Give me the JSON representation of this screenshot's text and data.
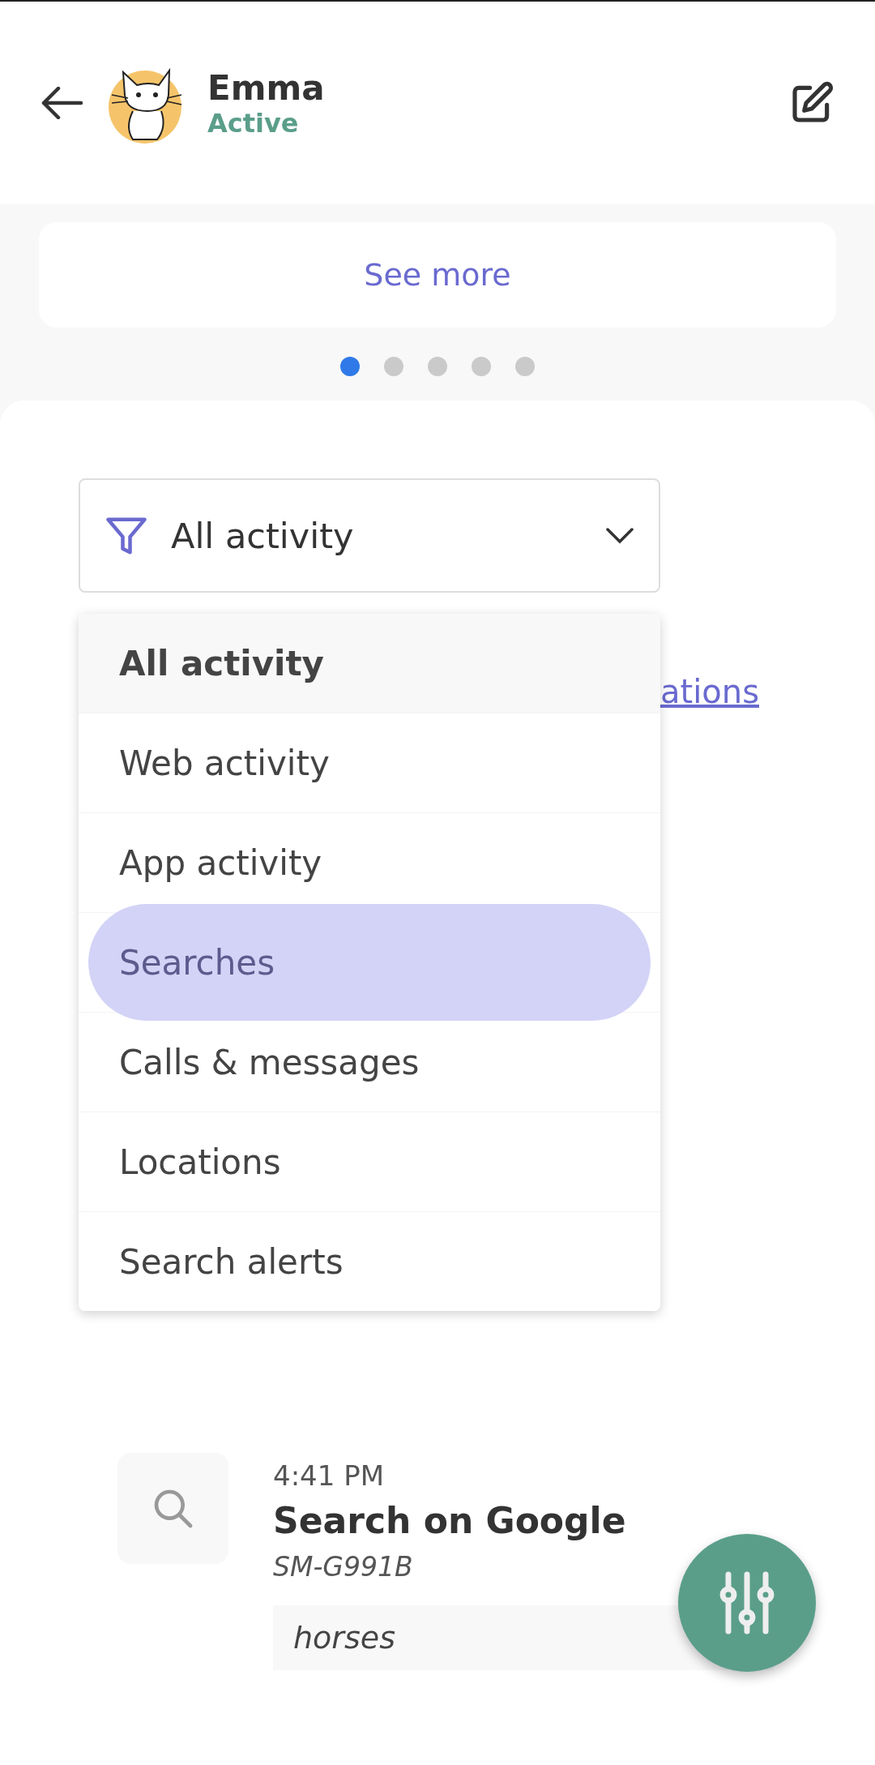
{
  "header": {
    "name": "Emma",
    "status": "Active"
  },
  "card": {
    "link": "See more"
  },
  "pager": [
    {
      "selected": true
    },
    {
      "selected": false
    },
    {
      "selected": false
    },
    {
      "selected": false
    },
    {
      "selected": false
    }
  ],
  "filter": {
    "value": "All activity",
    "expanded": true,
    "options": [
      {
        "label": "All activity",
        "selected": true,
        "highlighted": false
      },
      {
        "label": "Web activity",
        "selected": false,
        "highlighted": false
      },
      {
        "label": "App activity",
        "selected": false,
        "highlighted": false
      },
      {
        "label": "Searches",
        "selected": false,
        "highlighted": true
      },
      {
        "label": "Calls & messages",
        "selected": false,
        "highlighted": false
      },
      {
        "label": "Locations",
        "selected": false,
        "highlighted": false
      },
      {
        "label": "Search alerts",
        "selected": false,
        "highlighted": false
      }
    ]
  },
  "partial_link": "ations",
  "activity": {
    "time": "4:41 PM",
    "title": "Search on Google",
    "device": "SM-G991B",
    "query": "horses"
  }
}
